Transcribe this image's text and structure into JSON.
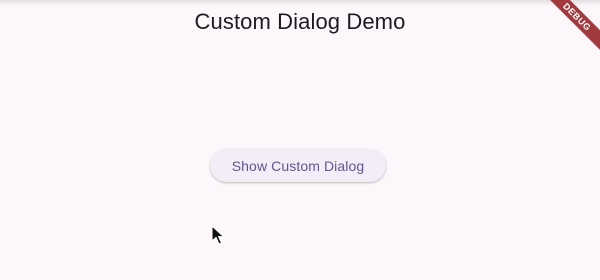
{
  "app_bar": {
    "title": "Custom Dialog Demo"
  },
  "main": {
    "show_dialog_button_label": "Show Custom Dialog"
  },
  "debug_banner": {
    "label": "DEBUG"
  },
  "colors": {
    "background": "#fdf7fb",
    "button_bg": "#f2edf6",
    "button_text": "#65558f",
    "debug_ribbon": "#a03a3f"
  },
  "icons": {
    "cursor": "mouse-pointer-icon"
  }
}
